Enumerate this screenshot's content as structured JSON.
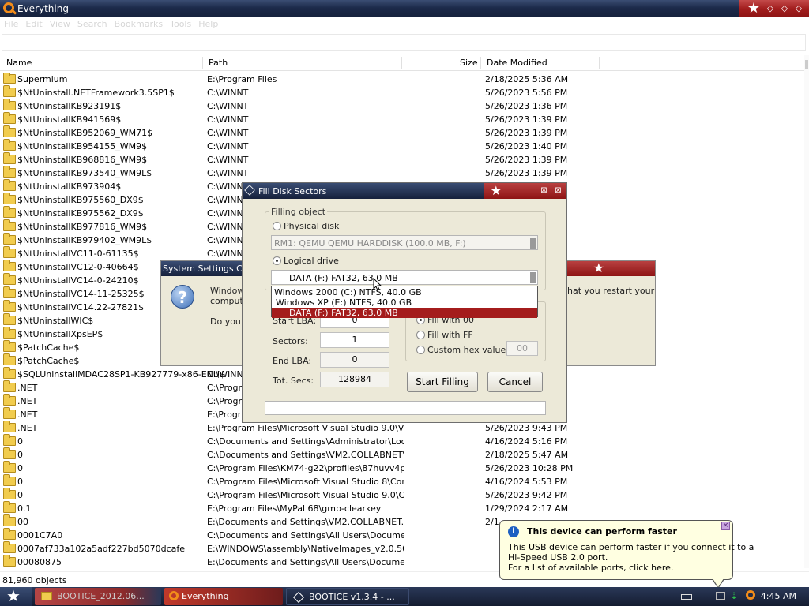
{
  "app": {
    "title": "Everything",
    "menu": [
      "File",
      "Edit",
      "View",
      "Search",
      "Bookmarks",
      "Tools",
      "Help"
    ],
    "columns": {
      "name": "Name",
      "path": "Path",
      "size": "Size",
      "date": "Date Modified"
    },
    "rows": [
      {
        "name": "Supermium",
        "path": "E:\\Program Files",
        "date": "2/18/2025 5:36 AM"
      },
      {
        "name": "$NtUninstall.NETFramework3.5SP1$",
        "path": "C:\\WINNT",
        "date": "5/26/2023 5:56 PM"
      },
      {
        "name": "$NtUninstallKB923191$",
        "path": "C:\\WINNT",
        "date": "5/26/2023 1:36 PM"
      },
      {
        "name": "$NtUninstallKB941569$",
        "path": "C:\\WINNT",
        "date": "5/26/2023 1:39 PM"
      },
      {
        "name": "$NtUninstallKB952069_WM71$",
        "path": "C:\\WINNT",
        "date": "5/26/2023 1:39 PM"
      },
      {
        "name": "$NtUninstallKB954155_WM9$",
        "path": "C:\\WINNT",
        "date": "5/26/2023 1:40 PM"
      },
      {
        "name": "$NtUninstallKB968816_WM9$",
        "path": "C:\\WINNT",
        "date": "5/26/2023 1:39 PM"
      },
      {
        "name": "$NtUninstallKB973540_WM9L$",
        "path": "C:\\WINNT",
        "date": "5/26/2023 1:39 PM"
      },
      {
        "name": "$NtUninstallKB973904$",
        "path": "C:\\WINN",
        "date": ""
      },
      {
        "name": "$NtUninstallKB975560_DX9$",
        "path": "C:\\WINN",
        "date": ""
      },
      {
        "name": "$NtUninstallKB975562_DX9$",
        "path": "C:\\WINN",
        "date": ""
      },
      {
        "name": "$NtUninstallKB977816_WM9$",
        "path": "C:\\WINN",
        "date": ""
      },
      {
        "name": "$NtUninstallKB979402_WM9L$",
        "path": "C:\\WINN",
        "date": ""
      },
      {
        "name": "$NtUninstallVC11-0-61135$",
        "path": "C:\\WINN",
        "date": ""
      },
      {
        "name": "$NtUninstallVC12-0-40664$",
        "path": "",
        "date": ""
      },
      {
        "name": "$NtUninstallVC14-0-24210$",
        "path": "",
        "date": ""
      },
      {
        "name": "$NtUninstallVC14-11-25325$",
        "path": "",
        "date": ""
      },
      {
        "name": "$NtUninstallVC14.22-27821$",
        "path": "",
        "date": ""
      },
      {
        "name": "$NtUninstallWIC$",
        "path": "",
        "date": ""
      },
      {
        "name": "$NtUninstallXpsEP$",
        "path": "",
        "date": ""
      },
      {
        "name": "$PatchCache$",
        "path": "",
        "date": ""
      },
      {
        "name": "$PatchCache$",
        "path": "",
        "date": ""
      },
      {
        "name": "$SQLUninstallMDAC28SP1-KB927779-x86-ENU$",
        "path": "C:\\WINN",
        "date": ""
      },
      {
        "name": ".NET",
        "path": "C:\\Progra",
        "date": ""
      },
      {
        "name": ".NET",
        "path": "C:\\Progra",
        "date": ""
      },
      {
        "name": ".NET",
        "path": "E:\\Program F",
        "date": ""
      },
      {
        "name": ".NET",
        "path": "E:\\Program Files\\Microsoft Visual Studio 9.0\\VC\\V...",
        "date": "5/26/2023 9:43 PM"
      },
      {
        "name": "0",
        "path": "C:\\Documents and Settings\\Administrator\\Local S...",
        "date": "4/16/2024 5:16 PM"
      },
      {
        "name": "0",
        "path": "C:\\Documents and Settings\\VM2.COLLABNET\\Loc...",
        "date": "2/18/2025 5:47 AM"
      },
      {
        "name": "0",
        "path": "C:\\Program Files\\KM74-g22\\profiles\\87huvv4p.d...",
        "date": "5/26/2023 10:28 PM"
      },
      {
        "name": "0",
        "path": "C:\\Program Files\\Microsoft Visual Studio 8\\Comm...",
        "date": "4/16/2024 5:53 PM"
      },
      {
        "name": "0",
        "path": "C:\\Program Files\\Microsoft Visual Studio 9.0\\Com...",
        "date": "5/26/2023 9:42 PM"
      },
      {
        "name": "0.1",
        "path": "E:\\Program Files\\MyPal 68\\gmp-clearkey",
        "date": "1/29/2024 2:17 AM"
      },
      {
        "name": "00",
        "path": "E:\\Documents and Settings\\VM2.COLLABNET.00...",
        "date": "2/1"
      },
      {
        "name": "0001C7A0",
        "path": "C:\\Documents and Settings\\All Users\\Documents...",
        "date": ""
      },
      {
        "name": "0007af733a102a5adf227bd5070dcafe",
        "path": "E:\\WINDOWS\\assembly\\NativeImages_v2.0.507...",
        "date": ""
      },
      {
        "name": "00080875",
        "path": "E:\\Documents and Settings\\All Users\\Documents...",
        "date": ""
      }
    ],
    "status": "81,960 objects"
  },
  "sys_dialog": {
    "title": "System Settings Cha",
    "line1": "Windows",
    "line1b": "compute",
    "line2": "Do you w",
    "line_right": "hat you restart your"
  },
  "fill_dialog": {
    "title": "Fill Disk Sectors",
    "group_label": "Filling object",
    "physical_label": "Physical disk",
    "physical_value": "RM1: QEMU QEMU HARDDISK (100.0 MB, F:)",
    "logical_label": "Logical drive",
    "logical_value": "DATA (F:)  FAT32,  63.0 MB",
    "dropdown": [
      "Windows 2000 (C:)   NTFS,  40.0 GB",
      "Windows XP (E:)   NTFS,  40.0 GB",
      "DATA (F:)  FAT32,  63.0 MB"
    ],
    "start_lba_label": "Start LBA:",
    "start_lba": "0",
    "sectors_label": "Sectors:",
    "sectors": "1",
    "end_lba_label": "End LBA:",
    "end_lba": "0",
    "tot_label": "Tot. Secs:",
    "tot": "128984",
    "fill00_label": "Fill with 00",
    "fillff_label": "Fill with FF",
    "custom_label": "Custom hex value:",
    "custom_value": "00",
    "start_btn": "Start Filling",
    "cancel_btn": "Cancel"
  },
  "balloon": {
    "title": "This device can perform faster",
    "line1": "This USB device can perform faster if you connect it to a",
    "line2": "Hi-Speed USB 2.0 port.",
    "line3": "For a list of available ports, click here."
  },
  "taskbar": {
    "tasks": [
      "BOOTICE_2012.06...",
      "Everything",
      "BOOTICE v1.3.4 - ..."
    ],
    "clock": "4:45 AM"
  }
}
